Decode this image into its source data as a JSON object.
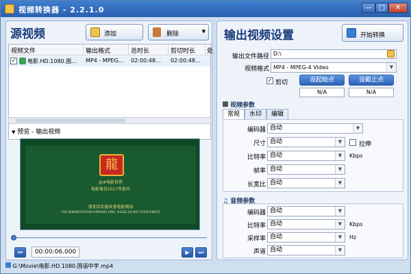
{
  "window": {
    "title": "视频转换器 - 2.2.1.0",
    "min_label": "—",
    "max_label": "□",
    "close_label": "✕"
  },
  "left": {
    "title": "源视频",
    "add_label": "添加",
    "delete_label": "删除",
    "columns": [
      "视频文件",
      "输出格式",
      "总时长",
      "剪切时长",
      "处"
    ],
    "row": {
      "file": "电影.HD.1080.国…",
      "format": "MP4 - MPEG…",
      "total": "02:00:48…",
      "cut": "02:00:48…",
      "checked": "✓"
    },
    "preview_label": "预览 - 输出视频",
    "video_lines": [
      "@#电影世界",
      "电影每日2017年影片",
      "请支持正版共享电影网站",
      "FOR DEMONSTRATION PURPOSES ONLY, PLEASE DO NOT REDISTRIBUTE"
    ],
    "time": "00:00:06.000",
    "controls": {
      "prev": "⏮",
      "play": "▶",
      "next": "⏭"
    }
  },
  "right": {
    "title": "输出视频设置",
    "start_label": "开始转换",
    "path_label": "输出文件路径",
    "path_value": "D:\\",
    "format_label": "视频格式",
    "format_value": "MP4 - MPEG-4 Video",
    "cut_label": "剪切",
    "cut_checked": "✓",
    "set_start_label": "设起始点",
    "set_end_label": "设截止点",
    "start_value": "N/A",
    "end_value": "N/A",
    "video_params_label": "视频参数",
    "tabs": [
      "常规",
      "水印",
      "编辑"
    ],
    "video_fields": [
      {
        "label": "编码器",
        "value": "自动"
      },
      {
        "label": "尺寸",
        "value": "自动"
      },
      {
        "label": "比特率",
        "value": "自动"
      },
      {
        "label": "帧率",
        "value": "自动"
      },
      {
        "label": "长宽比",
        "value": "自动"
      }
    ],
    "stretch_label": "拉伸",
    "kbps_unit": "Kbps",
    "audio_params_label": "音频参数",
    "audio_fields": [
      {
        "label": "编码器",
        "value": "自动"
      },
      {
        "label": "比特率",
        "value": "自动"
      },
      {
        "label": "采样率",
        "value": "自动"
      },
      {
        "label": "声道",
        "value": "自动"
      }
    ],
    "audio_kbps_unit": "Kbps",
    "hz_unit": "Hz"
  },
  "status": {
    "path": "G:\\Movie\\电影.HD.1080.国语中字.mp4"
  },
  "colors": {
    "accent": "#2b62b8",
    "title_text": "#1c3d7a",
    "video_bg": "#0f4a26"
  }
}
